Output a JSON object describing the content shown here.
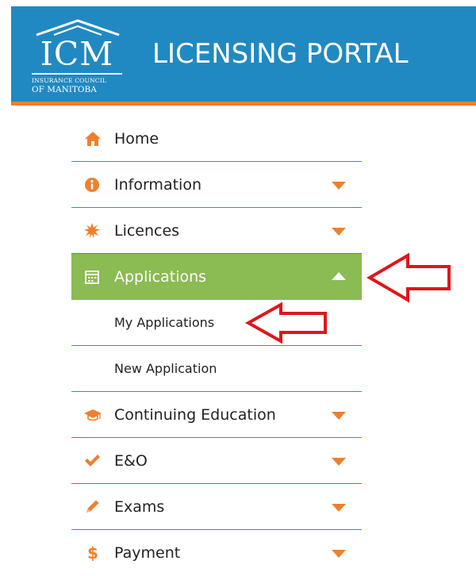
{
  "header": {
    "logo": {
      "letters": "ICM",
      "line1": "INSURANCE COUNCIL",
      "line2": "OF MANITOBA"
    },
    "title": "LICENSING PORTAL",
    "colors": {
      "bar": "#2189c1",
      "stripe": "#f07f2c"
    }
  },
  "menu": {
    "items": [
      {
        "label": "Home",
        "icon": "home-icon",
        "has_caret": false
      },
      {
        "label": "Information",
        "icon": "info-circle-icon",
        "has_caret": true
      },
      {
        "label": "Licences",
        "icon": "starburst-icon",
        "has_caret": true
      },
      {
        "label": "Applications",
        "icon": "calendar-icon",
        "has_caret": true,
        "expanded": true
      },
      {
        "label": "Continuing Education",
        "icon": "graduation-cap-icon",
        "has_caret": true
      },
      {
        "label": "E&O",
        "icon": "checkmark-icon",
        "has_caret": true
      },
      {
        "label": "Exams",
        "icon": "pencil-icon",
        "has_caret": true
      },
      {
        "label": "Payment",
        "icon": "dollar-icon",
        "has_caret": true
      }
    ],
    "applications_submenu": [
      {
        "label": "My Applications"
      },
      {
        "label": "New Application"
      }
    ],
    "colors": {
      "active_bg": "#8bbb53",
      "icon": "#f07f2c",
      "divider": "#2f8ec6"
    }
  },
  "annotations": {
    "arrow_color": "#e0161b"
  }
}
